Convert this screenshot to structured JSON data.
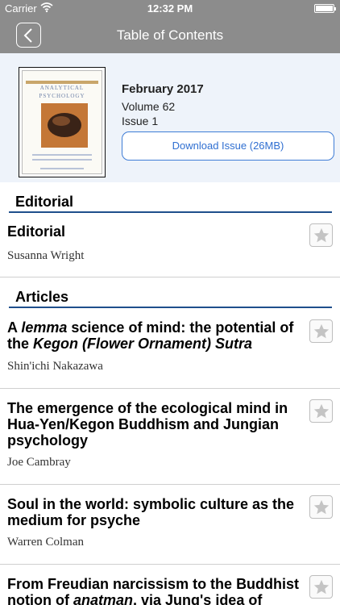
{
  "status": {
    "carrier": "Carrier",
    "time": "12:32 PM"
  },
  "nav": {
    "title": "Table of Contents"
  },
  "issue": {
    "date": "February 2017",
    "volume": "Volume 62",
    "number": "Issue 1",
    "download_label": "Download Issue (26MB)",
    "cover": {
      "line1": "ANALYTICAL",
      "line2": "PSYCHOLOGY"
    }
  },
  "sections": [
    {
      "heading": "Editorial"
    },
    {
      "heading": "Articles"
    }
  ],
  "items": [
    {
      "title_plain": "Editorial",
      "author": "Susanna Wright"
    },
    {
      "title_pre": "A ",
      "title_em1": "lemma",
      "title_mid": " science of mind: the potential of the ",
      "title_em2": "Kegon (Flower Ornament) Sutra",
      "author": "Shin'ichi Nakazawa"
    },
    {
      "title_plain": "The emergence of the ecological mind in Hua-Yen/Kegon Buddhism and Jungian psychology",
      "author": "Joe Cambray"
    },
    {
      "title_plain": "Soul in the world: symbolic culture as the medium for psyche",
      "author": "Warren Colman"
    },
    {
      "title_pre": "From Freudian narcissism to the Buddhist notion of ",
      "title_em1": "anatman",
      "title_post": ", via Jung's idea of"
    }
  ],
  "colors": {
    "nav": "#8c8c8c",
    "accent": "#2f6fd1",
    "rule": "#1f4f8c",
    "panel": "#eef3fa"
  }
}
